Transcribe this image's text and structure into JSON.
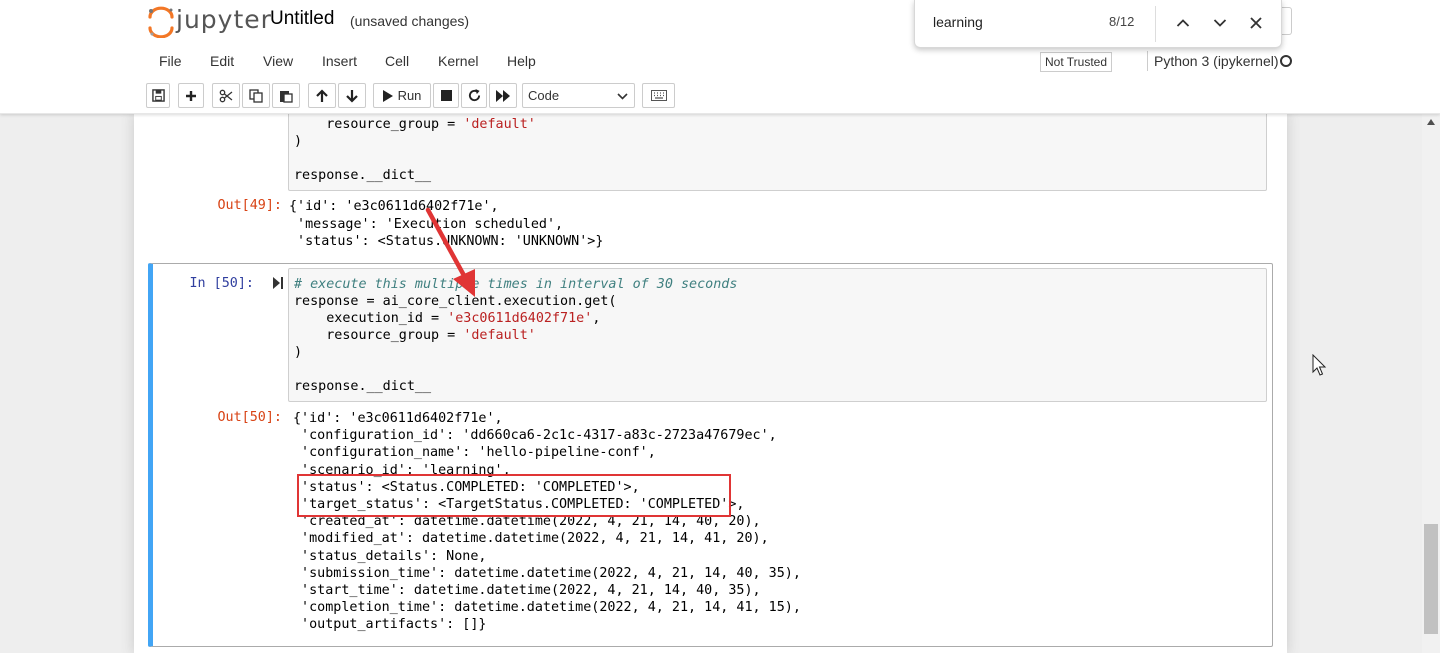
{
  "header": {
    "logo_text": "jupyter",
    "notebook_title": "Untitled",
    "save_status": "(unsaved changes)"
  },
  "find": {
    "query": "learning",
    "count": "8/12"
  },
  "menu": {
    "items": [
      "File",
      "Edit",
      "View",
      "Insert",
      "Cell",
      "Kernel",
      "Help"
    ],
    "trust_label": "Not Trusted",
    "kernel_name": "Python 3 (ipykernel)"
  },
  "toolbar": {
    "run_label": "Run",
    "cell_type": "Code"
  },
  "cells": {
    "prev_code_lines": [
      "    resource_group = 'default'",
      ")",
      "",
      "response.__dict__"
    ],
    "out49_prompt": "Out[49]:",
    "out49_lines": [
      "{'id': 'e3c0611d6402f71e',",
      " 'message': 'Execution scheduled',",
      " 'status': <Status.UNKNOWN: 'UNKNOWN'>}"
    ],
    "in50_prompt": "In [50]:",
    "in50_comment": "# execute this multiple times in interval of 30 seconds",
    "in50_lines": [
      "response = ai_core_client.execution.get(",
      "    execution_id = 'e3c0611d6402f71e',",
      "    resource_group = 'default'",
      ")",
      "",
      "response.__dict__"
    ],
    "out50_prompt": "Out[50]:",
    "out50_lines": [
      "{'id': 'e3c0611d6402f71e',",
      " 'configuration_id': 'dd660ca6-2c1c-4317-a83c-2723a47679ec',",
      " 'configuration_name': 'hello-pipeline-conf',",
      " 'scenario_id': 'learning',",
      " 'status': <Status.COMPLETED: 'COMPLETED'>,",
      " 'target_status': <TargetStatus.COMPLETED: 'COMPLETED'>,",
      " 'created_at': datetime.datetime(2022, 4, 21, 14, 40, 20),",
      " 'modified_at': datetime.datetime(2022, 4, 21, 14, 41, 20),",
      " 'status_details': None,",
      " 'submission_time': datetime.datetime(2022, 4, 21, 14, 40, 35),",
      " 'start_time': datetime.datetime(2022, 4, 21, 14, 40, 35),",
      " 'completion_time': datetime.datetime(2022, 4, 21, 14, 41, 15),",
      " 'output_artifacts': []}"
    ]
  },
  "colors": {
    "accent": "#42a5f5",
    "annotation": "#e03535"
  }
}
